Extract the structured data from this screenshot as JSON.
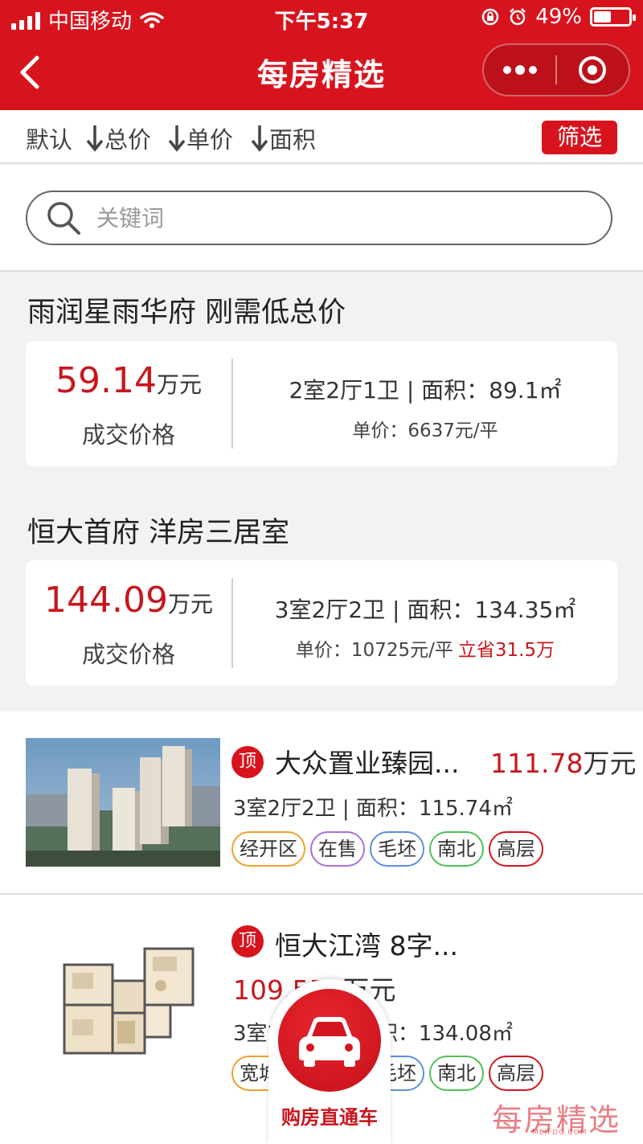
{
  "status_bar": {
    "carrier": "中国移动",
    "time": "下午5:37",
    "battery_text": "49%",
    "battery_level": 0.49
  },
  "nav": {
    "title": "每房精选"
  },
  "sort_bar": {
    "items": [
      "默认",
      "总价",
      "单价",
      "面积"
    ],
    "filter_label": "筛选"
  },
  "search": {
    "placeholder": "关键词"
  },
  "deals": [
    {
      "title": "雨润星雨华府 刚需低总价",
      "price": "59.14",
      "price_unit": "万元",
      "price_label": "成交价格",
      "spec": "2室2厅1卫 | 面积：89.1㎡",
      "unit_price": "单价：6637元/平",
      "saving": ""
    },
    {
      "title": "恒大首府 洋房三居室",
      "price": "144.09",
      "price_unit": "万元",
      "price_label": "成交价格",
      "spec": "3室2厅2卫 | 面积：134.35㎡",
      "unit_price": "单价：10725元/平",
      "saving": "立省31.5万"
    }
  ],
  "listings": [
    {
      "badge": "顶",
      "name": "大众置业臻园...",
      "price": "111.78",
      "price_unit": "万元",
      "spec": "3室2厅2卫 | 面积：115.74㎡",
      "tags": [
        {
          "label": "经开区",
          "color": "#f0a030"
        },
        {
          "label": "在售",
          "color": "#a770d8"
        },
        {
          "label": "毛坯",
          "color": "#5b8fe0"
        },
        {
          "label": "南北",
          "color": "#4fbf5a"
        },
        {
          "label": "高层",
          "color": "#d7141e"
        }
      ]
    },
    {
      "badge": "顶",
      "name": "恒大江湾 8字...",
      "price": "109.551",
      "price_unit": "万元",
      "spec": "3室2厅2卫 | 面积：134.08㎡",
      "tags": [
        {
          "label": "宽城区",
          "color": "#f0a030"
        },
        {
          "label": "在售",
          "color": "#a770d8"
        },
        {
          "label": "毛坯",
          "color": "#5b8fe0"
        },
        {
          "label": "南北",
          "color": "#4fbf5a"
        },
        {
          "label": "高层",
          "color": "#d7141e"
        }
      ]
    }
  ],
  "float_button": {
    "label": "购房直通车"
  },
  "watermark": {
    "text": "每房精选",
    "sub": "MEIFDC.COM"
  },
  "colors": {
    "brand_red": "#d7141e",
    "price_red": "#c8161d"
  }
}
